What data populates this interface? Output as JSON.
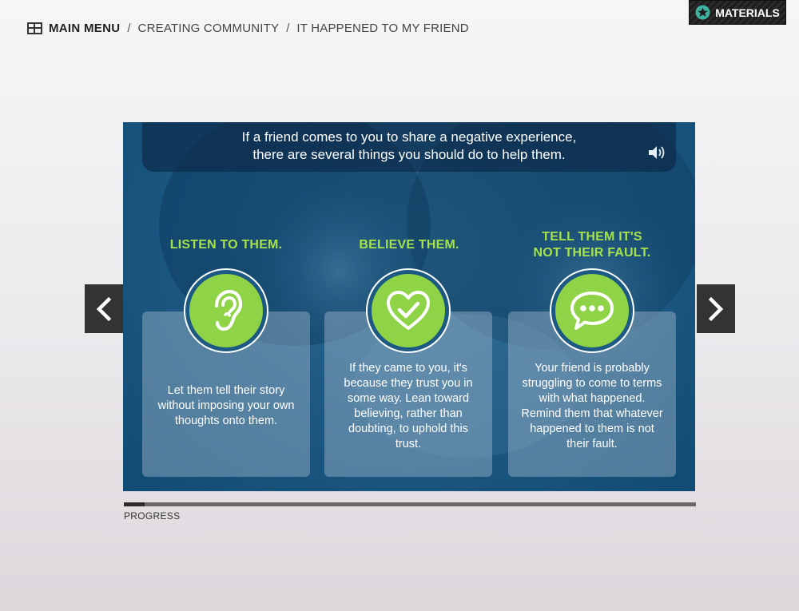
{
  "breadcrumb": {
    "main_menu": "MAIN MENU",
    "separator": "/",
    "items": [
      "CREATING COMMUNITY",
      "IT HAPPENED TO MY FRIEND"
    ]
  },
  "materials": {
    "label": "MATERIALS",
    "icon": "star-badge-icon"
  },
  "slide": {
    "intro_line1": "If a friend comes to you to share a negative experience,",
    "intro_line2": "there are several things you should do to help them.",
    "audio_icon": "speaker-icon",
    "columns": [
      {
        "title_line1": "LISTEN TO THEM.",
        "title_line2": "",
        "icon": "ear-icon",
        "text": "Let them tell their story without imposing your own thoughts onto them."
      },
      {
        "title_line1": "BELIEVE THEM.",
        "title_line2": "",
        "icon": "heart-check-icon",
        "text": "If they came to you, it's because they trust you in some way. Lean toward believing, rather than doubting, to uphold this trust."
      },
      {
        "title_line1": "TELL THEM IT'S",
        "title_line2": "NOT THEIR FAULT.",
        "icon": "speech-bubble-icon",
        "text": "Your friend is probably struggling to come to terms with what happened. Remind them that whatever happened to them is not their fault."
      }
    ]
  },
  "navigation": {
    "prev_icon": "chevron-left-icon",
    "next_icon": "chevron-right-icon"
  },
  "progress": {
    "label": "PROGRESS",
    "value_percent": 3.7
  },
  "colors": {
    "accent_green": "#8fd346",
    "title_green": "#a6e249",
    "slide_blue": "#1f5a84",
    "dark": "#333333"
  }
}
